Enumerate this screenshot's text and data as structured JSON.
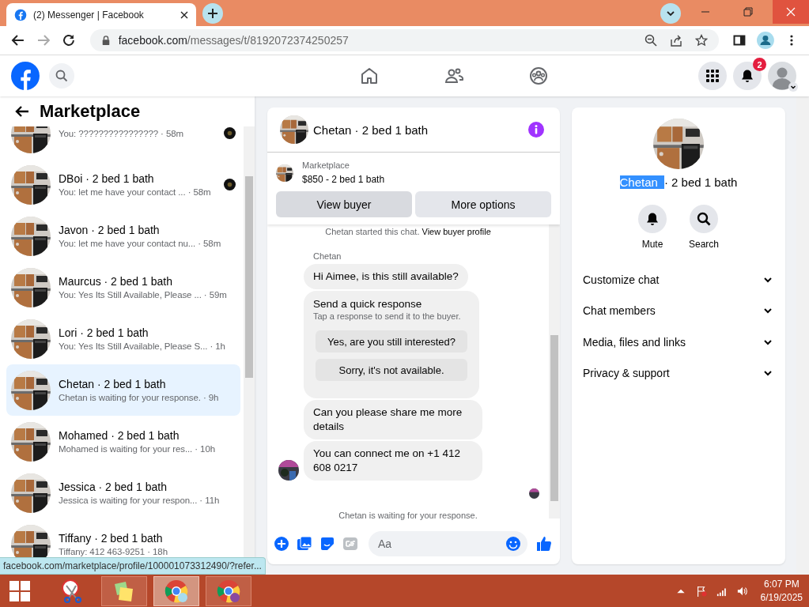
{
  "browser": {
    "tab": {
      "title": "(2) Messenger | Facebook"
    },
    "url": {
      "host": "facebook.com",
      "path": "/messages/t/8192072374250257"
    },
    "forward_disabled": true
  },
  "facebook_header": {
    "notification_count": "2"
  },
  "sidebar": {
    "title": "Marketplace",
    "items": [
      {
        "preview": "You: ????????????????",
        "time": "· 58m",
        "selected": false,
        "seen_avatar": true
      },
      {
        "title": "DBoi · 2 bed 1 bath",
        "preview": "You: let me have your contact ...",
        "time": "· 58m",
        "selected": false,
        "seen_avatar": true
      },
      {
        "title": "Javon · 2 bed 1 bath",
        "preview": "You: let me have your contact nu...",
        "time": "· 58m",
        "selected": false,
        "seen_avatar": false
      },
      {
        "title": "Maurcus · 2 bed 1 bath",
        "preview": "You: Yes Its Still Available, Please ...",
        "time": "· 59m",
        "selected": false,
        "seen_avatar": false
      },
      {
        "title": "Lori · 2 bed 1 bath",
        "preview": "You: Yes Its Still Available, Please S...",
        "time": "· 1h",
        "selected": false,
        "seen_avatar": false
      },
      {
        "title": "Chetan · 2 bed 1 bath",
        "preview": "Chetan is waiting for your response.",
        "time": "· 9h",
        "selected": true,
        "seen_avatar": false
      },
      {
        "title": "Mohamed · 2 bed 1 bath",
        "preview": "Mohamed is waiting for your res...",
        "time": "· 10h",
        "selected": false,
        "seen_avatar": false
      },
      {
        "title": "Jessica · 2 bed 1 bath",
        "preview": "Jessica is waiting for your respon...",
        "time": "· 11h",
        "selected": false,
        "seen_avatar": false
      },
      {
        "title": "Tiffany · 2 bed 1 bath",
        "preview": "Tiffany: 412 463-9251",
        "time": "· 18h",
        "selected": false,
        "seen_avatar": false
      }
    ]
  },
  "chat": {
    "title": "Chetan · 2 bed 1 bath",
    "listing": {
      "label": "Marketplace",
      "name": "$850 - 2 bed 1 bath"
    },
    "buttons": [
      "View buyer",
      "More options"
    ],
    "system": {
      "text": "Chetan started this chat.",
      "link": "View buyer profile"
    },
    "sender": "Chetan",
    "messages": [
      {
        "kind": "text",
        "text": "Hi Aimee, is this still available?"
      },
      {
        "kind": "quick_response",
        "title": "Send a quick response",
        "subtitle": "Tap a response to send it to the buyer.",
        "options": [
          "Yes, are you still interested?",
          "Sorry, it's not available."
        ]
      },
      {
        "kind": "text",
        "text": "Can you please share me more details"
      },
      {
        "kind": "text",
        "text": "You can connect me on +1 412 608 0217"
      }
    ],
    "footer": "Chetan is waiting for your response.",
    "composer": {
      "placeholder": "Aa"
    }
  },
  "details": {
    "name": "Chetan",
    "name_selected": true,
    "subtitle": "· 2 bed 1 bath",
    "actions": [
      {
        "kind": "mute",
        "label": "Mute"
      },
      {
        "kind": "search",
        "label": "Search"
      }
    ],
    "menu": [
      "Customize chat",
      "Chat members",
      "Media, files and links",
      "Privacy & support"
    ]
  },
  "status_url": "facebook.com/marketplace/profile/100001073312490/?refer...",
  "taskbar": {
    "apps": [
      {
        "kind": "snipping",
        "running": false,
        "selected": false
      },
      {
        "kind": "sticky",
        "running": true,
        "selected": false
      },
      {
        "kind": "chrome",
        "running": true,
        "selected": true
      },
      {
        "kind": "chrome_badge",
        "running": true,
        "selected": false
      }
    ],
    "time": "6:07 PM",
    "date": "6/19/2025"
  }
}
